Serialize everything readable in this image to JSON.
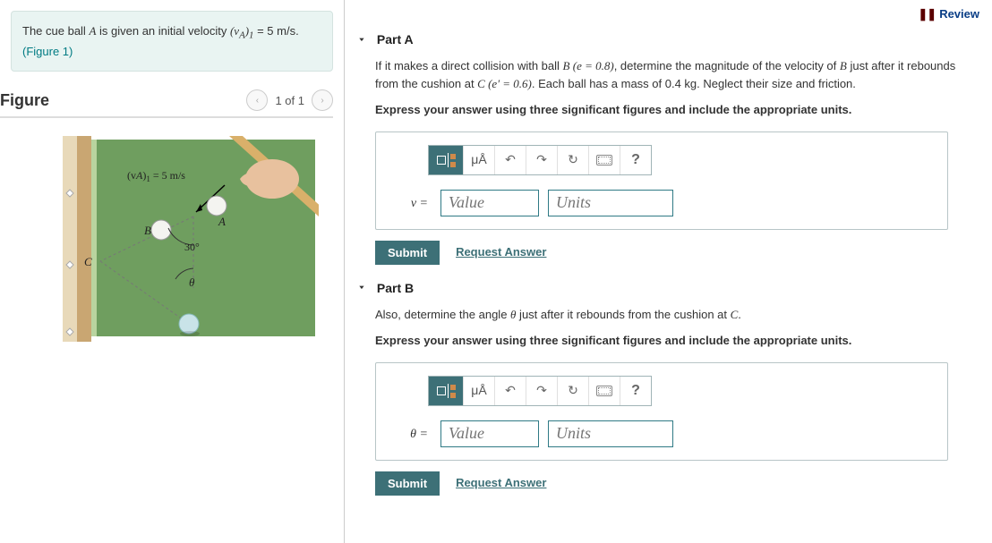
{
  "review_label": "Review",
  "problem_statement": {
    "line1_pre": "The cue ball ",
    "ball_a": "A",
    "line1_mid": " is given an initial velocity ",
    "va_expr": "(v",
    "va_sub": "A",
    "va_paren": ")",
    "va_sub2": "1",
    "va_eq": " = 5 m/s.",
    "figure_link": "(Figure 1)"
  },
  "figure": {
    "title": "Figure",
    "pager_text": "1 of 1",
    "diagram": {
      "velocity_label": "(vA)1 = 5 m/s",
      "point_a": "A",
      "point_b": "B",
      "point_c": "C",
      "angle": "30°",
      "theta": "θ"
    }
  },
  "partA": {
    "title": "Part A",
    "desc_pre": "If it makes a direct collision with ball ",
    "ball_b": "B",
    "e_val": " (e = 0.8)",
    "desc_mid": ", determine the magnitude of the velocity of ",
    "desc_mid2": " just after it rebounds from the cushion at ",
    "ball_c": "C",
    "eprime_val": " (e′ = 0.6)",
    "desc_end": ". Each ball has a mass of 0.4 kg. Neglect their size and friction.",
    "instr": "Express your answer using three significant figures and include the appropriate units.",
    "var_label": "v =",
    "value_placeholder": "Value",
    "units_placeholder": "Units",
    "submit": "Submit",
    "request": "Request Answer",
    "toolbar": {
      "ua": "μÅ",
      "undo": "↶",
      "redo": "↷",
      "reset": "↻",
      "help": "?"
    }
  },
  "partB": {
    "title": "Part B",
    "desc_pre": "Also, determine the angle ",
    "theta": "θ",
    "desc_mid": " just after it rebounds from the cushion at ",
    "ball_c": "C",
    "desc_end": ".",
    "instr": "Express your answer using three significant figures and include the appropriate units.",
    "var_label": "θ =",
    "value_placeholder": "Value",
    "units_placeholder": "Units",
    "submit": "Submit",
    "request": "Request Answer"
  }
}
